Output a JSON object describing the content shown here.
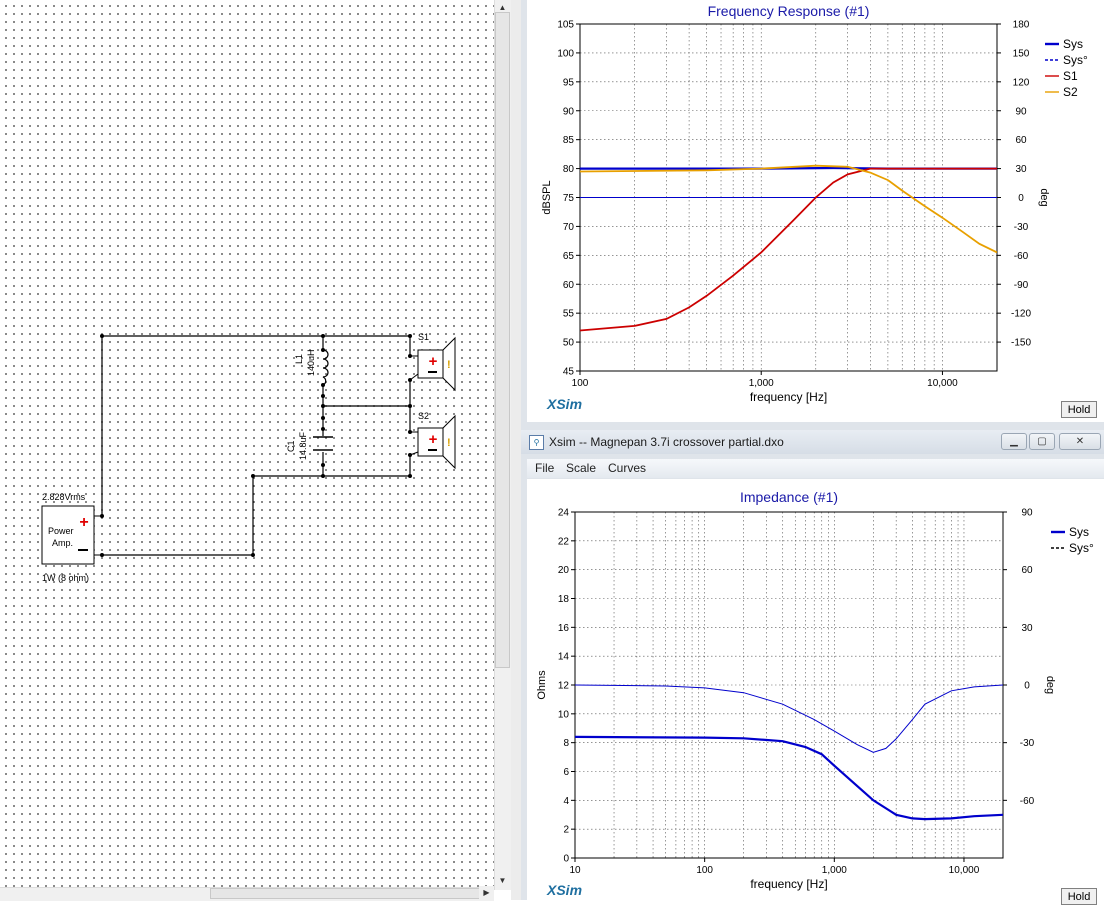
{
  "schematic": {
    "source_label": "2.828Vrms",
    "amp_label_line1": "Power",
    "amp_label_line2": "Amp.",
    "amp_rating": "1W (8 ohm)",
    "l1_name": "L1",
    "l1_value": "140uH",
    "c1_name": "C1",
    "c1_value": "14.8uF",
    "s1_name": "S1",
    "s2_name": "S2"
  },
  "freq_window": {
    "footer_brand": "XSim",
    "hold_label": "Hold"
  },
  "imp_window": {
    "title": "Xsim -- Magnepan 3.7i crossover partial.dxo",
    "menu": [
      "File",
      "Scale",
      "Curves"
    ],
    "footer_brand": "XSim",
    "hold_label": "Hold"
  },
  "chart_data": [
    {
      "type": "line",
      "title": "Frequency Response (#1)",
      "xlabel": "frequency [Hz]",
      "ylabel": "dBSPL",
      "y2label": "deg",
      "xscale": "log",
      "xlim": [
        100,
        20000
      ],
      "ylim": [
        45,
        105
      ],
      "y2lim": [
        -180,
        180
      ],
      "xticks": [
        "100",
        "1,000",
        "10,000"
      ],
      "yticks": [
        "45",
        "50",
        "55",
        "60",
        "65",
        "70",
        "75",
        "80",
        "85",
        "90",
        "95",
        "100",
        "105"
      ],
      "y2ticks": [
        "-150",
        "-120",
        "-90",
        "-60",
        "-30",
        "0",
        "30",
        "60",
        "90",
        "120",
        "150",
        "180"
      ],
      "grid": true,
      "legend_position": "right",
      "series": [
        {
          "name": "Sys",
          "axis": "left",
          "color": "#0000cc",
          "style": "solid-thick",
          "points": [
            [
              100,
              80
            ],
            [
              1000,
              80
            ],
            [
              2500,
              80.1
            ],
            [
              5000,
              80
            ],
            [
              20000,
              80
            ]
          ]
        },
        {
          "name": "Sys°",
          "axis": "right",
          "color": "#0000cc",
          "style": "dashed",
          "points": [
            [
              100,
              0
            ],
            [
              1000,
              0
            ],
            [
              5000,
              0
            ],
            [
              20000,
              0
            ]
          ]
        },
        {
          "name": "S1",
          "axis": "left",
          "color": "#cc0000",
          "style": "solid",
          "points": [
            [
              100,
              52
            ],
            [
              200,
              52.8
            ],
            [
              300,
              54
            ],
            [
              400,
              56
            ],
            [
              500,
              58
            ],
            [
              700,
              61.5
            ],
            [
              1000,
              65.5
            ],
            [
              1500,
              71
            ],
            [
              2000,
              75
            ],
            [
              2500,
              77.6
            ],
            [
              3000,
              79
            ],
            [
              4000,
              80
            ],
            [
              6000,
              80
            ],
            [
              10000,
              80
            ],
            [
              20000,
              80
            ]
          ]
        },
        {
          "name": "S2",
          "axis": "left",
          "color": "#e8a000",
          "style": "solid",
          "points": [
            [
              100,
              79.5
            ],
            [
              500,
              79.7
            ],
            [
              1000,
              80
            ],
            [
              2000,
              80.5
            ],
            [
              3000,
              80.3
            ],
            [
              4000,
              79.3
            ],
            [
              5000,
              78
            ],
            [
              6000,
              76.2
            ],
            [
              8000,
              73.5
            ],
            [
              10000,
              71.5
            ],
            [
              13000,
              69
            ],
            [
              16000,
              67
            ],
            [
              20000,
              65.5
            ]
          ]
        }
      ]
    },
    {
      "type": "line",
      "title": "Impedance (#1)",
      "xlabel": "frequency [Hz]",
      "ylabel": "Ohms",
      "y2label": "deg",
      "xscale": "log",
      "xlim": [
        10,
        20000
      ],
      "ylim": [
        0,
        24
      ],
      "y2lim": [
        -90,
        90
      ],
      "xticks": [
        "10",
        "100",
        "1,000",
        "10,000"
      ],
      "yticks": [
        "0",
        "2",
        "4",
        "6",
        "8",
        "10",
        "12",
        "14",
        "16",
        "18",
        "20",
        "22",
        "24"
      ],
      "y2ticks": [
        "-60",
        "-30",
        "0",
        "30",
        "60",
        "90"
      ],
      "grid": true,
      "legend_position": "right",
      "series": [
        {
          "name": "Sys",
          "axis": "left",
          "color": "#0000cc",
          "style": "solid-thick",
          "points": [
            [
              10,
              8.4
            ],
            [
              100,
              8.35
            ],
            [
              200,
              8.3
            ],
            [
              400,
              8.1
            ],
            [
              600,
              7.7
            ],
            [
              800,
              7.2
            ],
            [
              1000,
              6.4
            ],
            [
              1500,
              5.0
            ],
            [
              2000,
              4.0
            ],
            [
              3000,
              3.0
            ],
            [
              4000,
              2.75
            ],
            [
              5000,
              2.7
            ],
            [
              8000,
              2.75
            ],
            [
              12000,
              2.9
            ],
            [
              20000,
              3.0
            ]
          ]
        },
        {
          "name": "Sys°",
          "axis": "right",
          "color": "#0000cc",
          "style": "solid-thin",
          "points": [
            [
              10,
              0
            ],
            [
              50,
              -0.5
            ],
            [
              100,
              -1.5
            ],
            [
              200,
              -4
            ],
            [
              400,
              -10
            ],
            [
              700,
              -18
            ],
            [
              1000,
              -24
            ],
            [
              1500,
              -31
            ],
            [
              2000,
              -35
            ],
            [
              2500,
              -33
            ],
            [
              3000,
              -28
            ],
            [
              4000,
              -18
            ],
            [
              5000,
              -10
            ],
            [
              8000,
              -3
            ],
            [
              12000,
              -1
            ],
            [
              20000,
              0
            ]
          ]
        }
      ]
    }
  ]
}
